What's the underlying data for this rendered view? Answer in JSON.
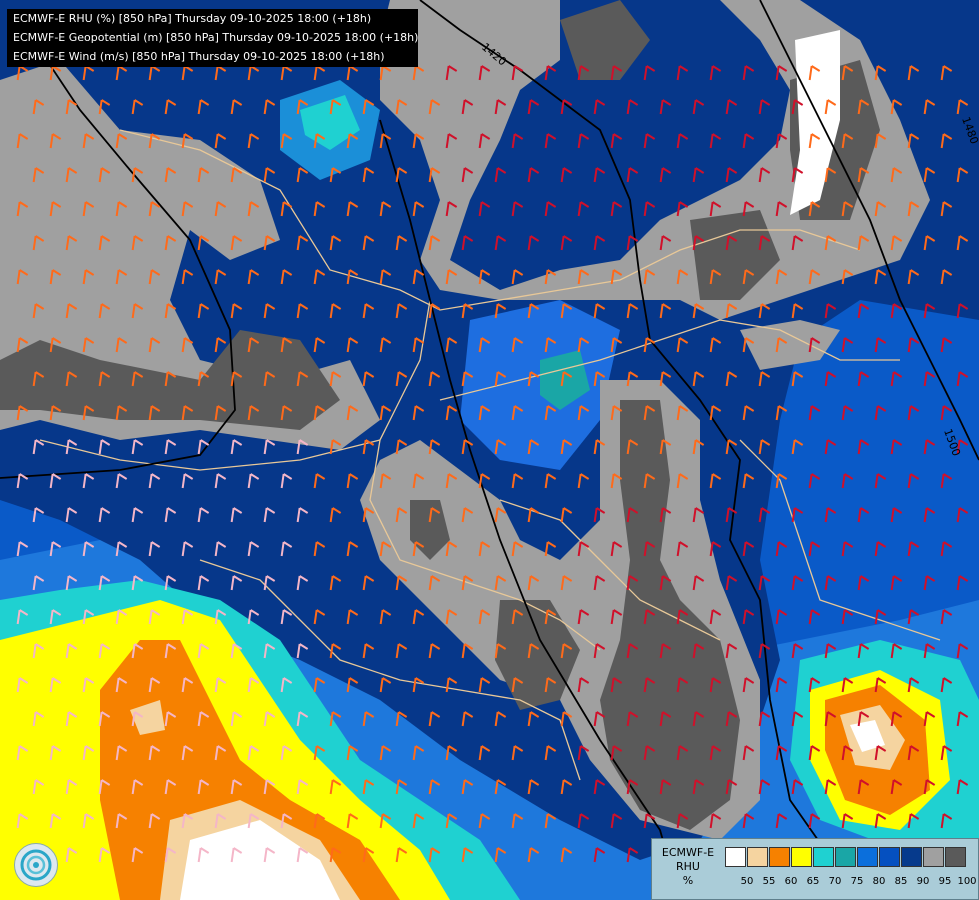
{
  "header": {
    "lines": [
      "ECMWF-E RHU (%) [850 hPa] Thursday 09-10-2025 18:00 (+18h)",
      "ECMWF-E Geopotential (m) [850 hPa] Thursday 09-10-2025 18:00 (+18h)",
      "ECMWF-E Wind (m/s) [850 hPa] Thursday 09-10-2025 18:00 (+18h)"
    ]
  },
  "contour_labels": [
    "1420",
    "1480",
    "1500"
  ],
  "legend": {
    "title_line1": "ECMWF-E",
    "title_line2": "RHU",
    "title_line3": "%",
    "colors": [
      "#ffffff",
      "#f5d4a0",
      "#f68100",
      "#ffff00",
      "#1fd1d1",
      "#1aa6a6",
      "#0b6fdc",
      "#0550c0",
      "#063a8c",
      "#a0a0a0",
      "#5a5a5a"
    ],
    "ticks": [
      "50",
      "55",
      "60",
      "65",
      "70",
      "75",
      "80",
      "85",
      "90",
      "95",
      "100"
    ]
  },
  "logo": {
    "icon": "ecmwf-logo-icon"
  }
}
